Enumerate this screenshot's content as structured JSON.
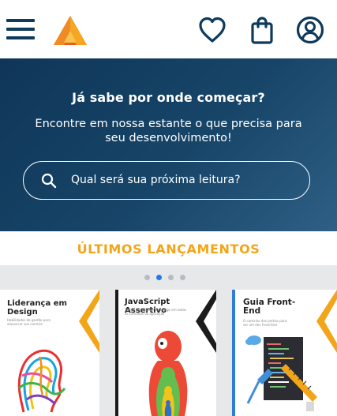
{
  "header": {
    "menu_icon": "hamburger-menu-icon",
    "logo": "triangle-logo",
    "wishlist_icon": "heart-icon",
    "bag_icon": "shopping-bag-icon",
    "account_icon": "user-circle-icon",
    "brand_colors": {
      "logo_orange": "#f5a623",
      "logo_red": "#ef5a2b",
      "icon_navy": "#0e3a5c"
    }
  },
  "hero": {
    "title": "Já sabe por onde começar?",
    "subtitle": "Encontre em nossa estante o que precisa para seu desenvolvimento!",
    "search": {
      "placeholder": "Qual será sua próxima leitura?",
      "value": "",
      "icon": "search-icon"
    },
    "background": "#174568"
  },
  "releases": {
    "title": "ÚLTIMOS LANÇAMENTOS",
    "title_color": "#f3a51a",
    "carousel": {
      "dots": 4,
      "active_dot": 2,
      "books": [
        {
          "title": "Liderança em Design",
          "subtitle": "Habilidades de gestão para alavancar sua carreira",
          "accent": "#f3a51a"
        },
        {
          "title": "JavaScript Assertivo",
          "subtitle": "Testes e qualidade de código em todas as camadas da aplicação",
          "accent": "#1c1c1c"
        },
        {
          "title": "Guia Front-End",
          "subtitle": "O caminho das pedras para ser um dev Front-End",
          "accent": "#f3a51a"
        }
      ]
    }
  }
}
